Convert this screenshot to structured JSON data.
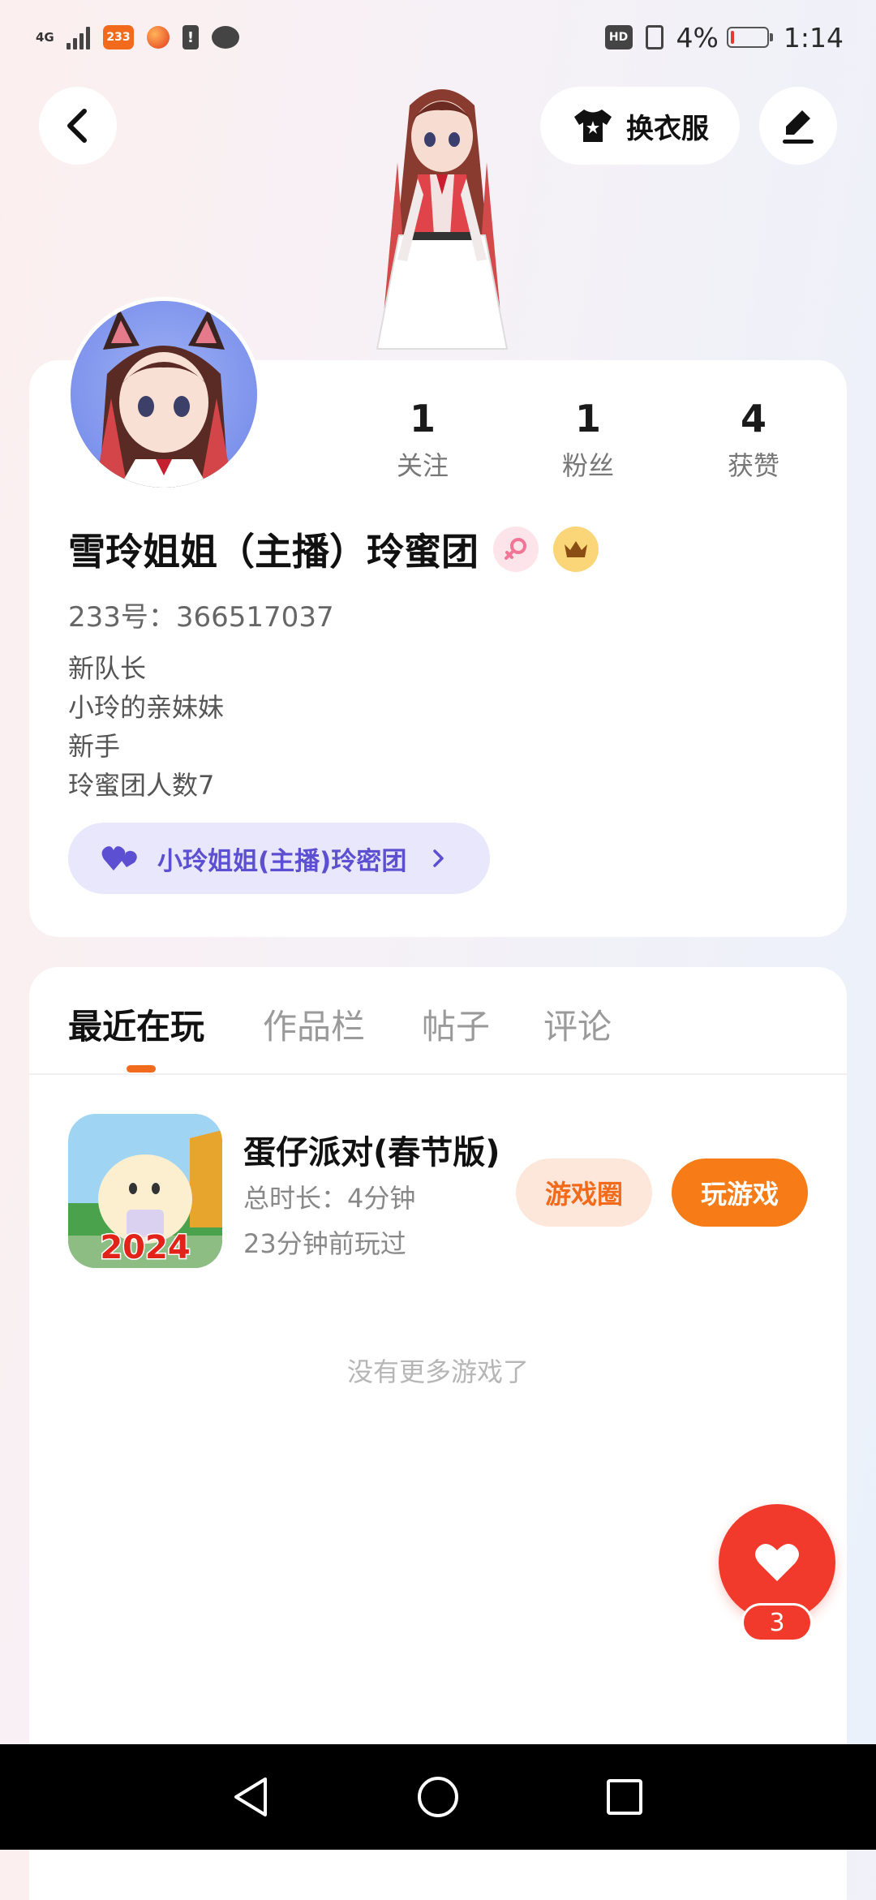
{
  "status_bar": {
    "network": "4G",
    "app_badge": "233",
    "hd": "HD",
    "battery": "4%",
    "time": "1:14"
  },
  "header": {
    "back_icon": "back-arrow-icon",
    "outfit_label": "换衣服",
    "edit_icon": "pen-icon"
  },
  "profile": {
    "stats": [
      {
        "value": "1",
        "label": "关注"
      },
      {
        "value": "1",
        "label": "粉丝"
      },
      {
        "value": "4",
        "label": "获赞"
      }
    ],
    "name": "雪玲姐姐（主播）玲蜜团",
    "uid": "233号：366517037",
    "bio": [
      "新队长",
      "小玲的亲妹妹",
      "新手",
      "玲蜜团人数7"
    ],
    "group_label": "小玲姐姐(主播)玲密团"
  },
  "tabs": [
    "最近在玩",
    "作品栏",
    "帖子",
    "评论"
  ],
  "active_tab": 0,
  "game": {
    "title": "蛋仔派对(春节版)",
    "duration": "总时长：4分钟",
    "last_played": "23分钟前玩过",
    "icon_text": "2024",
    "circle_label": "游戏圈",
    "play_label": "玩游戏"
  },
  "no_more": "没有更多游戏了",
  "like_count": "3",
  "colors": {
    "accent": "#f77b16",
    "like": "#f23a2c",
    "group": "#5c4fd1"
  }
}
